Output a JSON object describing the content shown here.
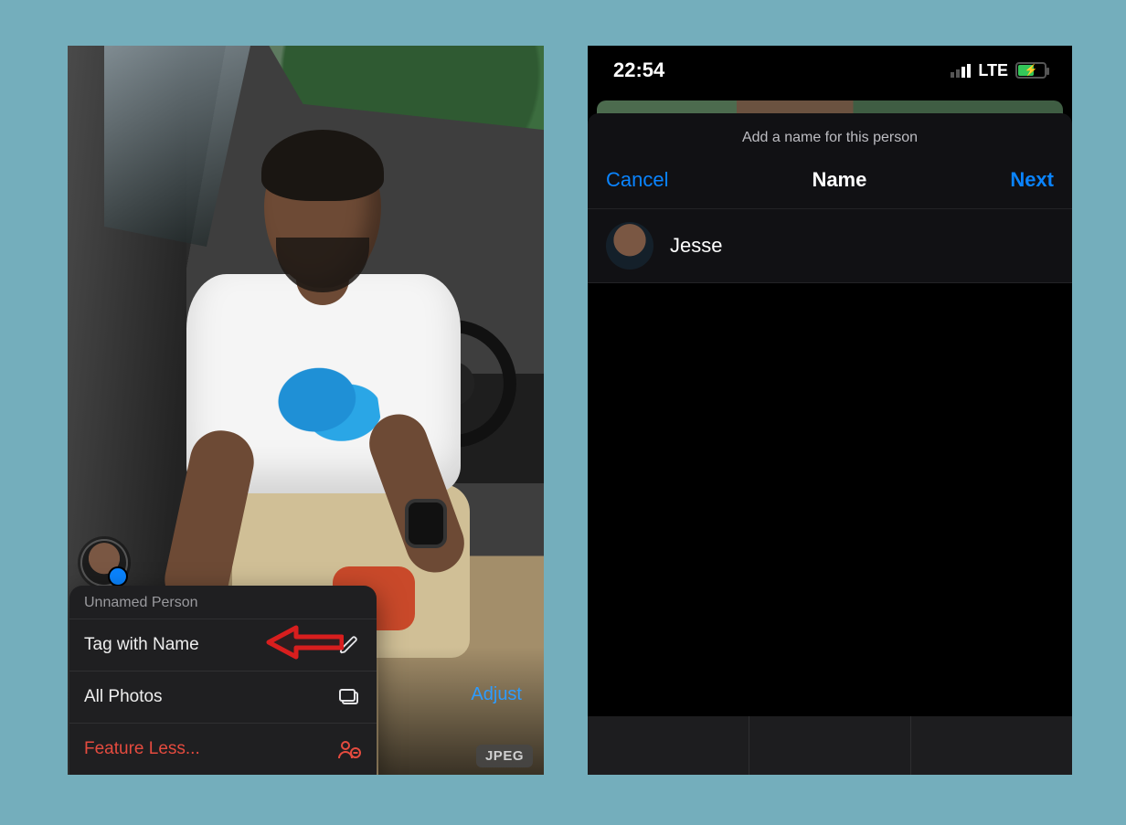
{
  "left": {
    "menu_header": "Unnamed Person",
    "rows": {
      "tag": "Tag with Name",
      "all": "All Photos",
      "less": "Feature Less..."
    },
    "adjust_label": "Adjust",
    "format_badge": "JPEG"
  },
  "right": {
    "status": {
      "time": "22:54",
      "network": "LTE"
    },
    "sheet": {
      "caption": "Add a name for this person",
      "cancel": "Cancel",
      "title": "Name",
      "next": "Next",
      "input_value": "Jesse"
    }
  }
}
